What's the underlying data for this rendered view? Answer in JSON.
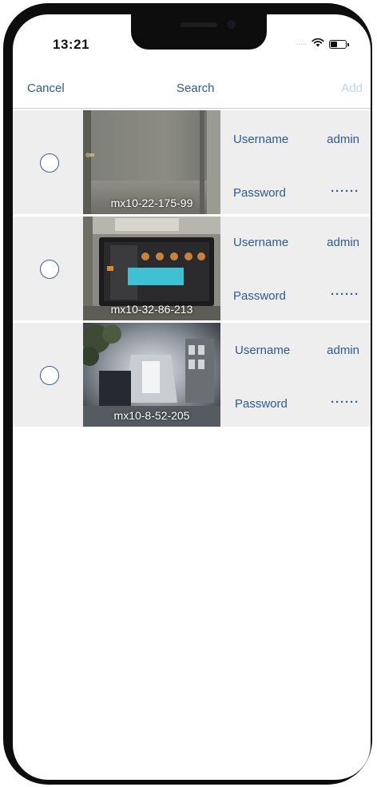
{
  "status_bar": {
    "time": "13:21",
    "signal_dots": "·····",
    "wifi_icon": "wifi-icon",
    "battery_icon": "battery-icon",
    "battery_level": 0.45
  },
  "navbar": {
    "cancel_label": "Cancel",
    "title": "Search",
    "add_label": "Add"
  },
  "cameras": [
    {
      "name": "mx10-22-175-99",
      "username_label": "Username",
      "username": "admin",
      "password_label": "Password",
      "password": "······",
      "selected": false
    },
    {
      "name": "mx10-32-86-213",
      "username_label": "Username",
      "username": "admin",
      "password_label": "Password",
      "password": "······",
      "selected": false
    },
    {
      "name": "mx10-8-52-205",
      "username_label": "Username",
      "username": "admin",
      "password_label": "Password",
      "password": "······",
      "selected": false
    }
  ],
  "colors": {
    "accent": "#2d5a9a",
    "disabled": "#c5d3e8",
    "row_background": "#eeeeee"
  }
}
